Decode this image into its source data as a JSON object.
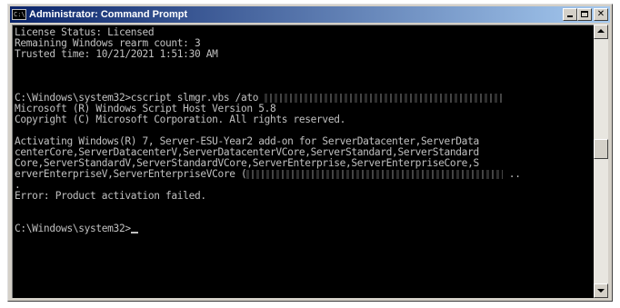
{
  "window": {
    "title": "Administrator: Command Prompt",
    "icon_label": "C:\\",
    "controls": {
      "minimize": "minimize-icon",
      "maximize": "maximize-icon",
      "close": "✕"
    }
  },
  "console": {
    "lines": [
      "License Status: Licensed",
      "Remaining Windows rearm count: 3",
      "Trusted time: 10/21/2021 1:51:30 AM",
      "",
      "",
      "C:\\Windows\\system32>cscript slmgr.vbs /ato",
      "Microsoft (R) Windows Script Host Version 5.8",
      "Copyright (C) Microsoft Corporation. All rights reserved.",
      "",
      "Activating Windows(R) 7, Server-ESU-Year2 add-on for ServerDatacenter,ServerData",
      "centerCore,ServerDatacenterV,ServerDatacenterVCore,ServerStandard,ServerStandard",
      "Core,ServerStandardV,ServerStandardVCore,ServerEnterprise,ServerEnterpriseCore,S",
      "erverEnterpriseV,ServerEnterpriseVCore (",
      ".",
      "Error: Product activation failed.",
      "",
      "",
      "C:\\Windows\\system32>"
    ],
    "redacted_suffix_line_12": " ..",
    "scroll_position": 0.45
  }
}
